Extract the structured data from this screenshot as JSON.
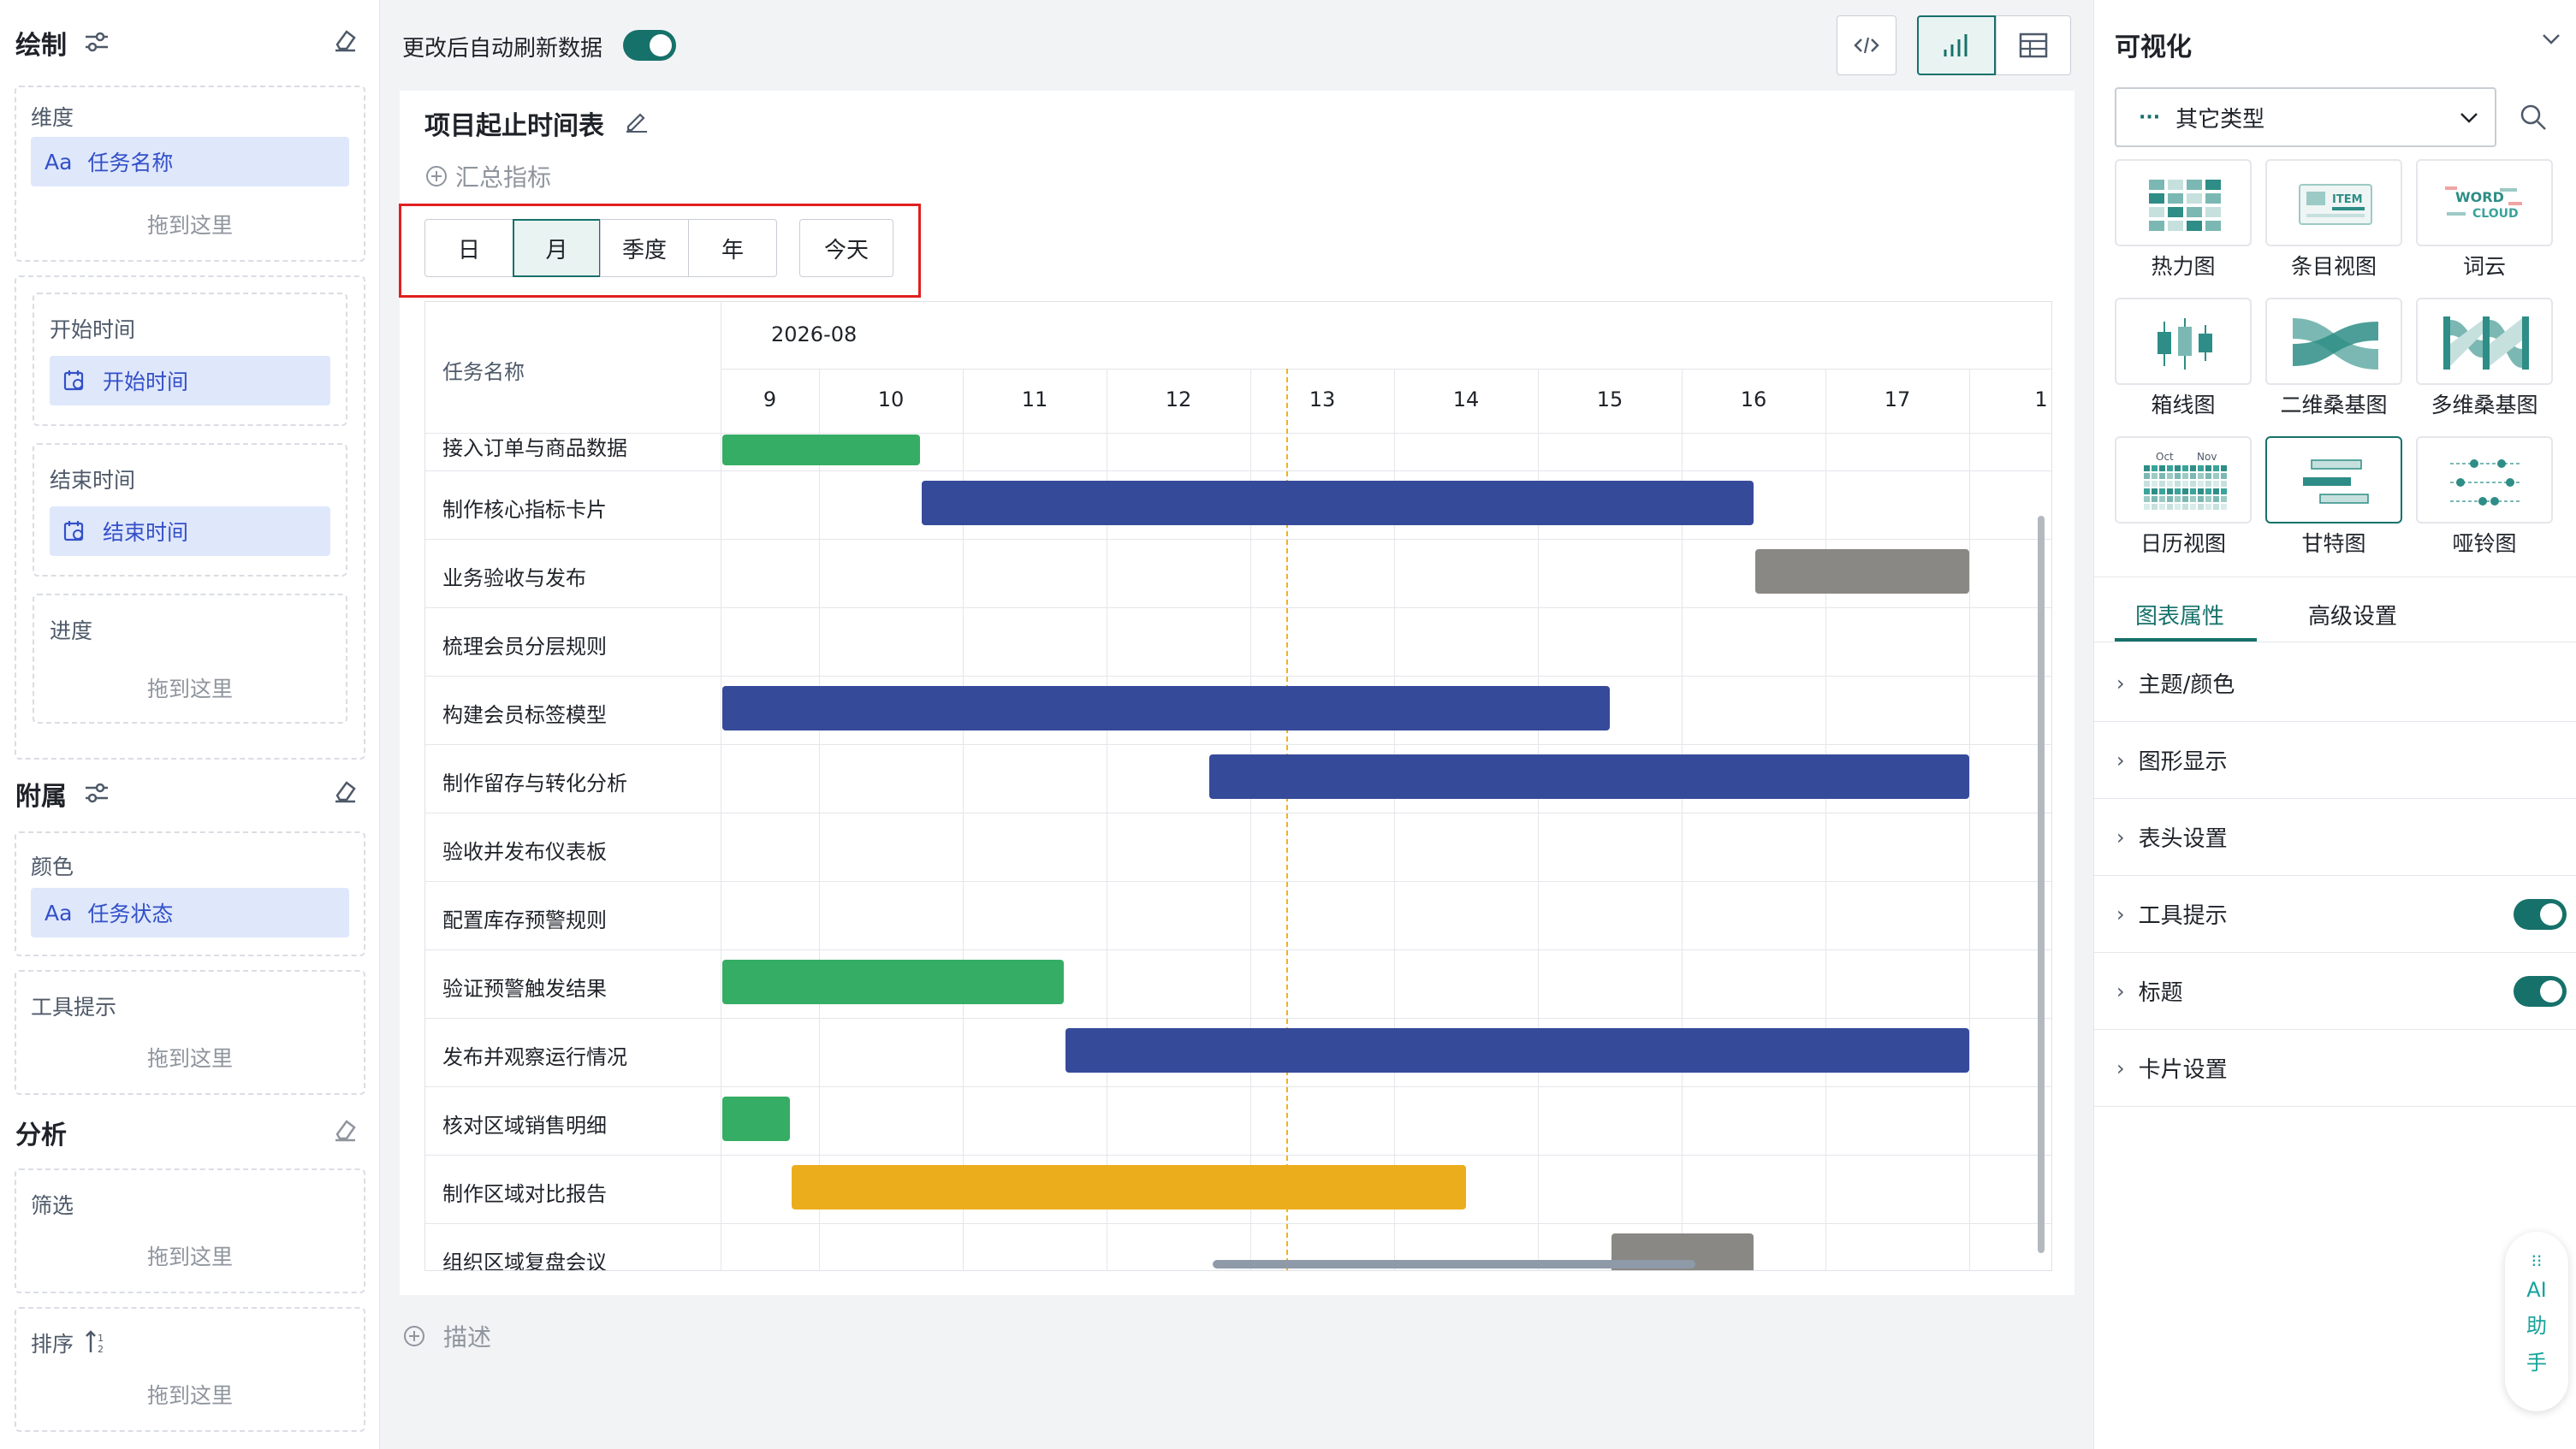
{
  "colors": {
    "accent": "#16716a",
    "chip_bg": "#dfe7fb",
    "chip_text": "#3350c8",
    "bar_green": "#36ad64",
    "bar_blue": "#364a9a",
    "bar_gray": "#8a8884",
    "bar_yellow": "#ecad1d",
    "today_line": "#f0b31e",
    "highlight_box": "#e02020"
  },
  "left": {
    "draw": {
      "title": "绘制",
      "sliders_icon": "sliders-icon",
      "eraser_icon": "eraser-icon"
    },
    "dimension": {
      "label": "维度",
      "chip_prefix": "Aa",
      "chip_label": "任务名称",
      "drop": "拖到这里"
    },
    "start_time": {
      "label": "开始时间",
      "chip_label": "开始时间",
      "icon": "calendar-icon"
    },
    "end_time": {
      "label": "结束时间",
      "chip_label": "结束时间",
      "icon": "calendar-icon"
    },
    "progress": {
      "label": "进度",
      "drop": "拖到这里"
    },
    "attach": {
      "title": "附属"
    },
    "color": {
      "label": "颜色",
      "chip_prefix": "Aa",
      "chip_label": "任务状态"
    },
    "tooltip": {
      "label": "工具提示",
      "drop": "拖到这里"
    },
    "analysis": {
      "title": "分析"
    },
    "filter": {
      "label": "筛选",
      "drop": "拖到这里"
    },
    "sort": {
      "label": "排序",
      "icon": "sort-icon",
      "drop": "拖到这里"
    }
  },
  "topbar": {
    "auto_refresh": "更改后自动刷新数据",
    "auto_refresh_on": true,
    "code_icon": "code-icon",
    "chart_icon": "bar-chart-icon",
    "table_icon": "table-icon"
  },
  "card": {
    "title": "项目起止时间表",
    "edit_icon": "pencil-icon",
    "summary": "汇总指标",
    "ranges": [
      "日",
      "月",
      "季度",
      "年"
    ],
    "active_range": "月",
    "today": "今天",
    "description": "描述"
  },
  "chart_data": {
    "type": "gantt",
    "header_label": "任务名称",
    "month": "2026-08",
    "days": [
      "9",
      "10",
      "11",
      "12",
      "13",
      "14",
      "15",
      "16",
      "17",
      "1"
    ],
    "today_marker": "13",
    "tasks": [
      {
        "name": "接入订单与商品数据",
        "start": 9.0,
        "end": 10.7,
        "color": "green"
      },
      {
        "name": "制作核心指标卡片",
        "start": 10.7,
        "end": 16.5,
        "color": "blue"
      },
      {
        "name": "业务验收与发布",
        "start": 16.5,
        "end": 18.0,
        "color": "gray"
      },
      {
        "name": "梳理会员分层规则",
        "start": null,
        "end": null,
        "color": ""
      },
      {
        "name": "构建会员标签模型",
        "start": 9.0,
        "end": 15.5,
        "color": "blue"
      },
      {
        "name": "制作留存与转化分析",
        "start": 12.7,
        "end": 18.0,
        "color": "blue"
      },
      {
        "name": "验收并发布仪表板",
        "start": null,
        "end": null,
        "color": ""
      },
      {
        "name": "配置库存预警规则",
        "start": null,
        "end": null,
        "color": ""
      },
      {
        "name": "验证预警触发结果",
        "start": 9.0,
        "end": 11.7,
        "color": "green"
      },
      {
        "name": "发布并观察运行情况",
        "start": 11.7,
        "end": 18.0,
        "color": "blue"
      },
      {
        "name": "核对区域销售明细",
        "start": 9.0,
        "end": 9.7,
        "color": "green"
      },
      {
        "name": "制作区域对比报告",
        "start": 9.7,
        "end": 14.5,
        "color": "yellow"
      },
      {
        "name": "组织区域复盘会议",
        "start": 15.5,
        "end": 16.5,
        "color": "gray"
      }
    ]
  },
  "right": {
    "title": "可视化",
    "collapse_icon": "chevron-down-icon",
    "type_select": {
      "prefix": "···",
      "value": "其它类型"
    },
    "search_icon": "search-icon",
    "chart_types": [
      {
        "label": "热力图",
        "icon": "heatmap-icon"
      },
      {
        "label": "条目视图",
        "icon": "item-view-icon"
      },
      {
        "label": "词云",
        "icon": "wordcloud-icon"
      },
      {
        "label": "箱线图",
        "icon": "boxplot-icon"
      },
      {
        "label": "二维桑基图",
        "icon": "sankey-2d-icon"
      },
      {
        "label": "多维桑基图",
        "icon": "sankey-multi-icon"
      },
      {
        "label": "日历视图",
        "icon": "calendar-view-icon"
      },
      {
        "label": "甘特图",
        "icon": "gantt-icon"
      },
      {
        "label": "哑铃图",
        "icon": "dumbbell-icon"
      }
    ],
    "selected_type": "甘特图",
    "item_icon_text": "ITEM",
    "wordcloud_text": [
      "WORD",
      "CLOUD"
    ],
    "calendar_months": [
      "Oct",
      "Nov"
    ],
    "tabs": [
      "图表属性",
      "高级设置"
    ],
    "active_tab": "图表属性",
    "properties": [
      {
        "label": "主题/颜色",
        "toggle": null
      },
      {
        "label": "图形显示",
        "toggle": null
      },
      {
        "label": "表头设置",
        "toggle": null
      },
      {
        "label": "工具提示",
        "toggle": true
      },
      {
        "label": "标题",
        "toggle": true
      },
      {
        "label": "卡片设置",
        "toggle": null
      }
    ],
    "ai": {
      "dots": "⁝⁝",
      "label_1": "AI",
      "label_2": "助",
      "label_3": "手"
    }
  }
}
